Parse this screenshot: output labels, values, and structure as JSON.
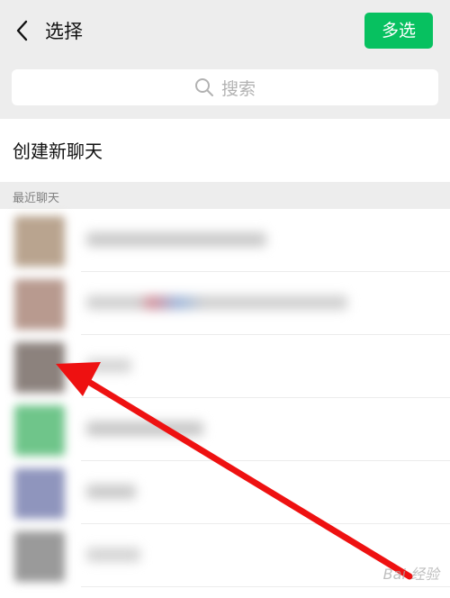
{
  "header": {
    "title": "选择",
    "multi_select_label": "多选",
    "back_icon": "chevron-left-icon"
  },
  "search": {
    "placeholder": "搜索",
    "icon": "search-icon"
  },
  "new_chat": {
    "label": "创建新聊天"
  },
  "recent": {
    "section_label": "最近聊天",
    "contacts": [
      {
        "avatar_color": "#b9a48f",
        "blurred_name": true
      },
      {
        "avatar_color": "#b89a8f",
        "blurred_name": true
      },
      {
        "avatar_color": "#8c827d",
        "blurred_name": true
      },
      {
        "avatar_color": "#6fc58a",
        "blurred_name": true
      },
      {
        "avatar_color": "#8f95bd",
        "blurred_name": true
      },
      {
        "avatar_color": "#9a9a9a",
        "blurred_name": true
      }
    ]
  },
  "annotation": {
    "arrow_color": "#ee1111",
    "watermark": "Bai 经验"
  },
  "colors": {
    "accent": "#07c160",
    "header_bg": "#ededed"
  }
}
